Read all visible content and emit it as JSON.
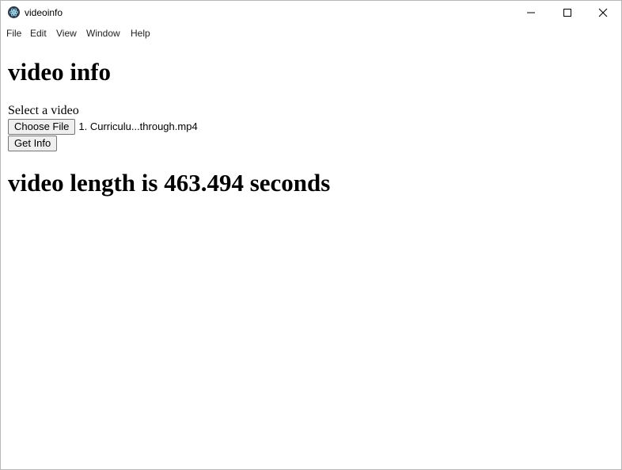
{
  "window": {
    "title": "videoinfo",
    "icons": {
      "app": "electron-app-icon",
      "minimize": "minimize-icon",
      "maximize": "maximize-icon",
      "close": "close-icon"
    }
  },
  "menu": {
    "items": [
      "File",
      "Edit",
      "View",
      "Window",
      "Help"
    ]
  },
  "page": {
    "heading": "video info",
    "select_label": "Select a video",
    "choose_file_button": "Choose File",
    "chosen_file_name": "1. Curriculu...through.mp4",
    "get_info_button": "Get Info",
    "result_text": "video length is 463.494 seconds"
  }
}
